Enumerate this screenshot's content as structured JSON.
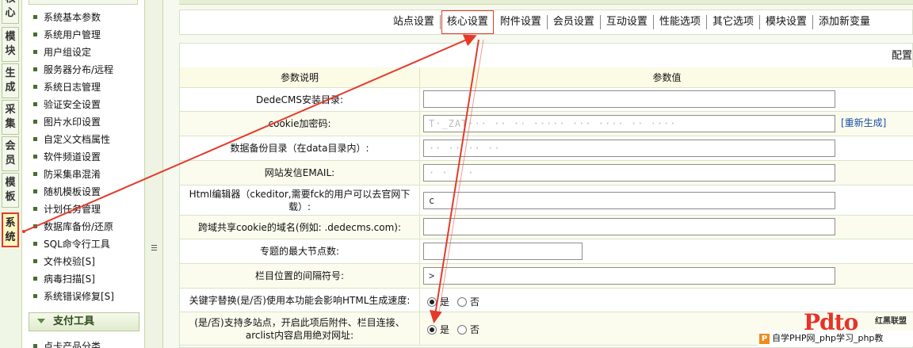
{
  "vertical_tabs": [
    {
      "label": "核心",
      "active": false
    },
    {
      "label": "模块",
      "active": false
    },
    {
      "label": "生成",
      "active": false
    },
    {
      "label": "采集",
      "active": false
    },
    {
      "label": "会员",
      "active": false
    },
    {
      "label": "模板",
      "active": false
    },
    {
      "label": "系统",
      "active": true
    }
  ],
  "menu": {
    "items": [
      "系统基本参数",
      "系统用户管理",
      "用户组设定",
      "服务器分布/远程",
      "系统日志管理",
      "验证安全设置",
      "图片水印设置",
      "自定义文档属性",
      "软件频道设置",
      "防采集串混淆",
      "随机模板设置",
      "计划任务管理",
      "数据库备份/还原",
      "SQL命令行工具",
      "文件校验[S]",
      "病毒扫描[S]",
      "系统错误修复[S]"
    ],
    "section": "支付工具",
    "section_first_item": "点卡产品分类"
  },
  "tabs": [
    {
      "label": "站点设置",
      "active": false
    },
    {
      "label": "核心设置",
      "active": true
    },
    {
      "label": "附件设置",
      "active": false
    },
    {
      "label": "会员设置",
      "active": false
    },
    {
      "label": "互动设置",
      "active": false
    },
    {
      "label": "性能选项",
      "active": false
    },
    {
      "label": "其它选项",
      "active": false
    },
    {
      "label": "模块设置",
      "active": false
    },
    {
      "label": "添加新变量",
      "active": false
    }
  ],
  "panel": {
    "title": "配置",
    "col_label": "参数说明",
    "col_value": "参数值",
    "rows": [
      {
        "label": "DedeCMS安装目录:",
        "type": "text",
        "value": "",
        "width": "wide"
      },
      {
        "label": "cookie加密码:",
        "type": "text",
        "value": "T·_ZAT··· ·· ·· ····· ··· ···· ·· ····",
        "blurred": true,
        "width": "wide",
        "link": "[重新生成]"
      },
      {
        "label": "数据备份目录（在data目录内）:",
        "type": "text",
        "value": "·· ·· ·· ··",
        "blurred": true,
        "width": "wide"
      },
      {
        "label": "网站发信EMAIL:",
        "type": "text",
        "value": "· · · ·",
        "blurred": true,
        "width": "wide"
      },
      {
        "label": "Html编辑器（ckeditor,需要fck的用户可以去官网下载）:",
        "type": "text",
        "value": "c",
        "width": "wide"
      },
      {
        "label": "跨域共享cookie的域名(例如: .dedecms.com):",
        "type": "text",
        "value": "",
        "width": "wide"
      },
      {
        "label": "专题的最大节点数:",
        "type": "text",
        "value": "",
        "width": "narrow"
      },
      {
        "label": "栏目位置的间隔符号:",
        "type": "text",
        "value": ">",
        "width": "wide"
      },
      {
        "label": "关键字替换(是/否)使用本功能会影响HTML生成速度:",
        "type": "radio",
        "options": [
          "是",
          "否"
        ],
        "selected": 0
      },
      {
        "label": "(是/否)支持多站点，开启此项后附件、栏目连接、arclist内容启用绝对网址:",
        "type": "radio",
        "options": [
          "是",
          "否"
        ],
        "selected": 0
      }
    ]
  },
  "watermark": {
    "logo": "Pdto",
    "side": "红黑联盟",
    "caption": "自学PHP网_php学习_php教"
  },
  "colors": {
    "accent_green": "#456f2c",
    "annotation_red": "#e53a2a",
    "link_blue": "#1a4fa8"
  }
}
